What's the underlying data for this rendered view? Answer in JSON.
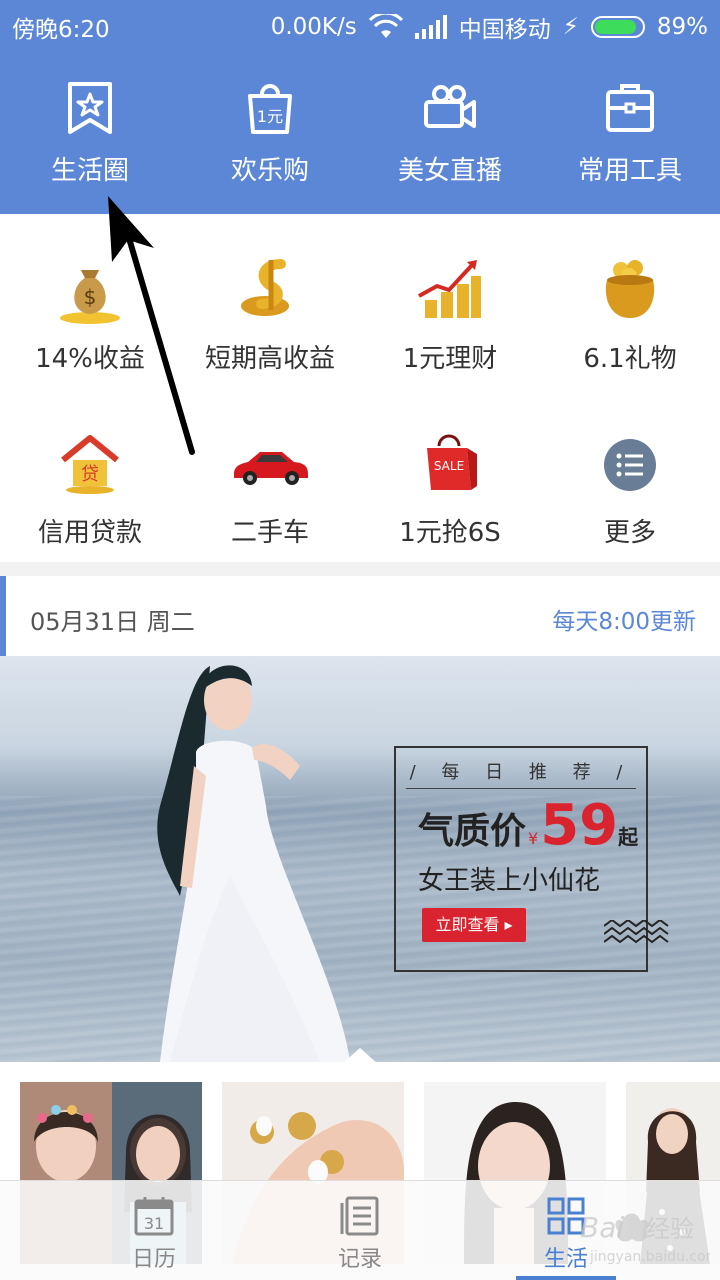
{
  "status_bar": {
    "time": "傍晚6:20",
    "speed": "0.00K/s",
    "carrier": "中国移动",
    "battery": "89%",
    "battery_level": 0.89
  },
  "top_nav": [
    {
      "label": "生活圈",
      "icon": "bookmark-star-icon"
    },
    {
      "label": "欢乐购",
      "icon": "shopping-bag-icon"
    },
    {
      "label": "美女直播",
      "icon": "video-camera-icon"
    },
    {
      "label": "常用工具",
      "icon": "toolbox-icon"
    }
  ],
  "grid": [
    {
      "label": "14%收益",
      "icon": "money-bag-icon"
    },
    {
      "label": "短期高收益",
      "icon": "gold-dollar-icon"
    },
    {
      "label": "1元理财",
      "icon": "coin-chart-icon"
    },
    {
      "label": "6.1礼物",
      "icon": "gold-pot-icon"
    },
    {
      "label": "信用贷款",
      "icon": "house-loan-icon"
    },
    {
      "label": "二手车",
      "icon": "red-car-icon"
    },
    {
      "label": "1元抢6S",
      "icon": "sale-bag-icon"
    },
    {
      "label": "更多",
      "icon": "more-list-icon"
    }
  ],
  "date_row": {
    "date": "05月31日 周二",
    "update": "每天8:00更新"
  },
  "banner": {
    "tag": "/ 每 日 推 荐 /",
    "price_label": "气质价",
    "currency": "¥",
    "price": "59",
    "price_suffix": "起",
    "slogan": "女王装上小仙花",
    "cta": "立即查看 ▸"
  },
  "tabs": [
    {
      "label": "日历",
      "icon": "calendar-icon",
      "badge": "31",
      "active": false
    },
    {
      "label": "记录",
      "icon": "record-list-icon",
      "active": false
    },
    {
      "label": "生活",
      "icon": "grid-squares-icon",
      "active": true
    }
  ],
  "watermark": "Baidu经验 jingyan.baidu.com",
  "colors": {
    "header_blue": "#5b87d6",
    "accent_red": "#d9232e",
    "active_tab": "#4a7fd1"
  }
}
